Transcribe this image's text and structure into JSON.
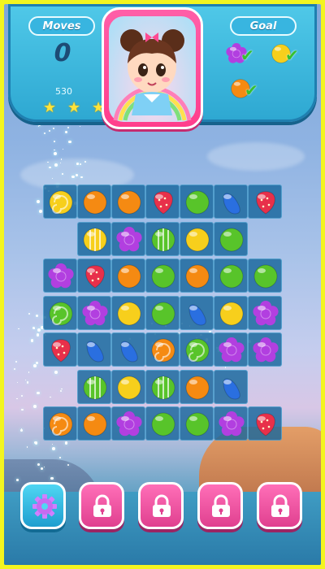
{
  "header": {
    "moves_label": "Moves",
    "moves_count": "0",
    "goal_label": "Goal",
    "score": "530",
    "stars_earned": 3,
    "stars_total": 3,
    "goals": [
      {
        "icon": "purple-flower-candy-icon",
        "color": "#b24ce0",
        "completed": true
      },
      {
        "icon": "yellow-candy-icon",
        "color": "#f5c71a",
        "completed": true
      },
      {
        "icon": "orange-candy-icon",
        "color": "#f07a10",
        "completed": true
      }
    ]
  },
  "board": {
    "rows": 7,
    "cols": 7,
    "cells": [
      [
        "yellow-swirl",
        "orange-round",
        "orange-round",
        "red-strawberry",
        "green-round",
        "blue-bean",
        "red-strawberry"
      ],
      [
        null,
        "yellow-striped",
        "purple-flower",
        "green-striped",
        "yellow-round",
        "green-round",
        null
      ],
      [
        "purple-flower",
        "red-strawberry",
        "orange-round",
        "green-round",
        "orange-round",
        "green-round",
        "green-round"
      ],
      [
        "green-swirl",
        "purple-flower",
        "yellow-round",
        "green-round",
        "blue-bean",
        "yellow-round",
        "purple-flower"
      ],
      [
        "red-strawberry",
        "blue-bean",
        "blue-bean",
        "orange-swirl",
        "green-swirl",
        "purple-flower",
        "purple-flower"
      ],
      [
        null,
        "green-striped",
        "yellow-round",
        "green-striped",
        "orange-round",
        "blue-bean",
        null
      ],
      [
        "orange-swirl",
        "orange-round",
        "purple-flower",
        "green-round",
        "green-round",
        "purple-flower",
        "red-strawberry"
      ]
    ],
    "palette": {
      "yellow": "#f7cf1c",
      "orange": "#f58a12",
      "red": "#e8304a",
      "green": "#58c42a",
      "blue": "#2a6fe0",
      "purple": "#b23fe0"
    }
  },
  "bottom_bar": {
    "buttons": [
      {
        "icon": "gear-icon",
        "locked": false
      },
      {
        "icon": "lock-icon",
        "locked": true
      },
      {
        "icon": "lock-icon",
        "locked": true
      },
      {
        "icon": "lock-icon",
        "locked": true
      },
      {
        "icon": "lock-icon",
        "locked": true
      }
    ]
  }
}
